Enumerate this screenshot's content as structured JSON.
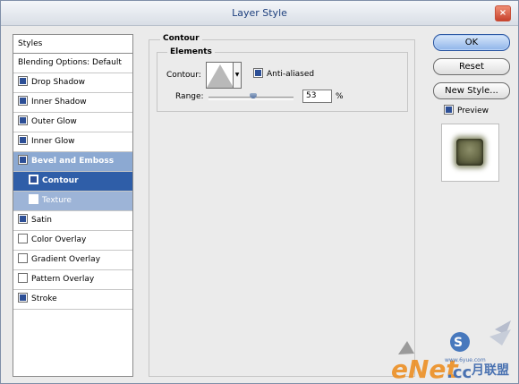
{
  "window": {
    "title": "Layer Style",
    "close_glyph": "×"
  },
  "styles_panel": {
    "header": "Styles",
    "items": [
      {
        "label": "Blending Options: Default",
        "checked": null,
        "state": "normal"
      },
      {
        "label": "Drop Shadow",
        "checked": true,
        "state": "normal"
      },
      {
        "label": "Inner Shadow",
        "checked": true,
        "state": "normal"
      },
      {
        "label": "Outer Glow",
        "checked": true,
        "state": "normal"
      },
      {
        "label": "Inner Glow",
        "checked": true,
        "state": "normal"
      },
      {
        "label": "Bevel and Emboss",
        "checked": true,
        "state": "parent-selected"
      },
      {
        "label": "Contour",
        "checked": true,
        "state": "selected"
      },
      {
        "label": "Texture",
        "checked": false,
        "state": "sub"
      },
      {
        "label": "Satin",
        "checked": true,
        "state": "normal"
      },
      {
        "label": "Color Overlay",
        "checked": false,
        "state": "normal"
      },
      {
        "label": "Gradient Overlay",
        "checked": false,
        "state": "normal"
      },
      {
        "label": "Pattern Overlay",
        "checked": false,
        "state": "normal"
      },
      {
        "label": "Stroke",
        "checked": true,
        "state": "normal"
      }
    ]
  },
  "contour_section": {
    "group_title": "Contour",
    "elements_title": "Elements",
    "contour_label": "Contour:",
    "anti_aliased_label": "Anti-aliased",
    "anti_aliased_checked": true,
    "range_label": "Range:",
    "range_value": "53",
    "range_unit": "%",
    "range_slider_fraction": 0.53
  },
  "buttons": {
    "ok": "OK",
    "reset": "Reset",
    "new_style": "New Style...",
    "preview_label": "Preview",
    "preview_checked": true
  },
  "watermark": {
    "text": "eNet",
    "text2": ".cc",
    "text3": "月联盟",
    "url": "www.6yue.com"
  },
  "colors": {
    "selected_bg": "#2f5ea8",
    "parent_bg": "#8ca9d2",
    "title_text": "#1d3f7d",
    "default_button": "#8fb4e9"
  }
}
